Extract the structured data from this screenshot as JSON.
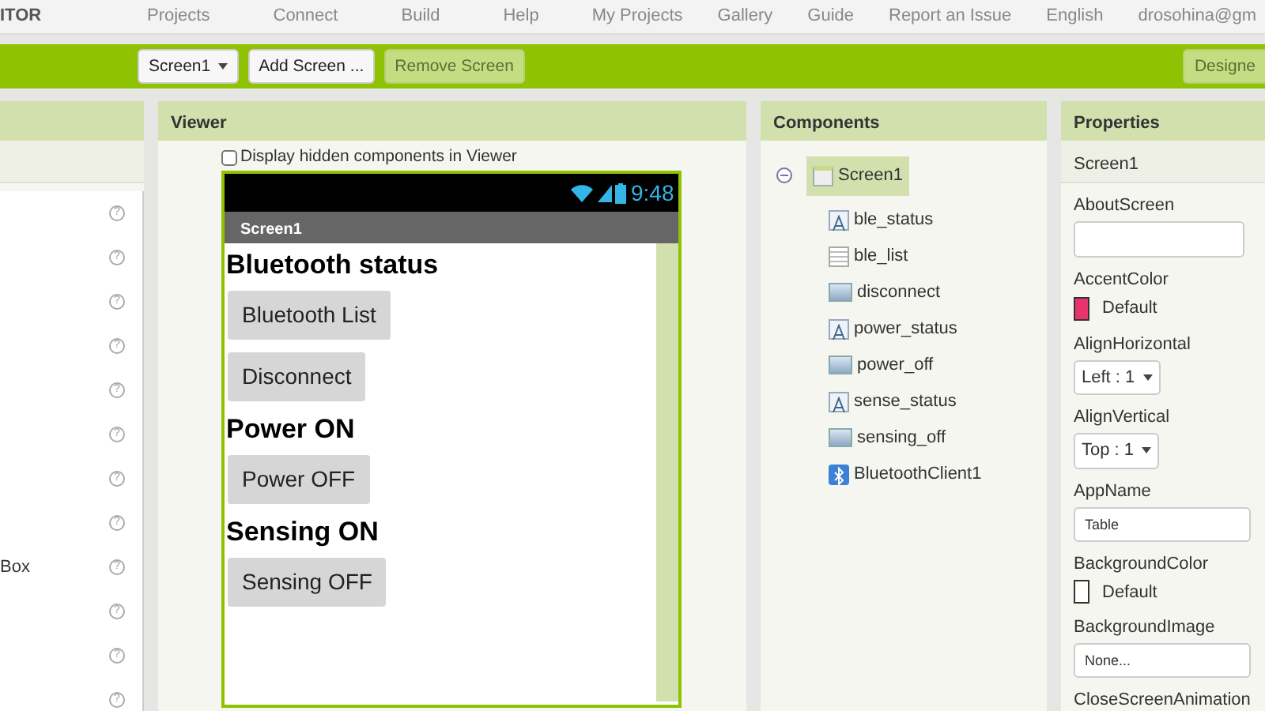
{
  "top_nav": {
    "logo": "ITOR",
    "left_links": [
      "Projects",
      "Connect",
      "Build",
      "Help"
    ],
    "right_links": [
      "My Projects",
      "Gallery",
      "Guide",
      "Report an Issue",
      "English",
      "drosohina@gm"
    ]
  },
  "toolbar": {
    "screen_select": "Screen1",
    "buttons": [
      {
        "label": "Add Screen ...",
        "disabled": false
      },
      {
        "label": "Remove Screen",
        "disabled": true
      }
    ],
    "designer": "Designe"
  },
  "palette": {
    "items": [
      {
        "help": "?"
      },
      {
        "help": "?"
      },
      {
        "help": "?"
      },
      {
        "help": "?"
      },
      {
        "help": "?"
      },
      {
        "help": "?"
      },
      {
        "help": "?"
      },
      {
        "help": "?"
      },
      {
        "label": "Box",
        "help": "?"
      },
      {
        "help": "?"
      },
      {
        "help": "?"
      },
      {
        "help": "?"
      }
    ]
  },
  "viewer": {
    "title": "Viewer",
    "hidden_checkbox": {
      "label": "Display hidden components in Viewer",
      "checked": false
    },
    "phone": {
      "time": "9:48",
      "screen_title": "Screen1",
      "components": [
        {
          "kind": "label",
          "text": "Bluetooth status"
        },
        {
          "kind": "button",
          "text": "Bluetooth List"
        },
        {
          "kind": "button",
          "text": "Disconnect"
        },
        {
          "kind": "label",
          "text": "Power ON"
        },
        {
          "kind": "button",
          "text": "Power OFF"
        },
        {
          "kind": "label",
          "text": "Sensing ON"
        },
        {
          "kind": "button",
          "text": "Sensing OFF"
        }
      ]
    }
  },
  "components": {
    "title": "Components",
    "root": {
      "label": "Screen1",
      "selected": true,
      "expanded": true,
      "children": [
        {
          "kind": "label",
          "label": "ble_status",
          "selected": false
        },
        {
          "kind": "listpicker",
          "label": "ble_list",
          "selected": false
        },
        {
          "kind": "button",
          "label": "disconnect",
          "selected": false
        },
        {
          "kind": "label",
          "label": "power_status",
          "selected": false
        },
        {
          "kind": "button",
          "label": "power_off",
          "selected": false
        },
        {
          "kind": "label",
          "label": "sense_status",
          "selected": false
        },
        {
          "kind": "button",
          "label": "sensing_off",
          "selected": false
        },
        {
          "kind": "bluetooth",
          "label": "BluetoothClient1",
          "selected": false
        }
      ]
    }
  },
  "properties": {
    "title": "Properties",
    "component": "Screen1",
    "items": [
      {
        "kind": "textarea",
        "label": "AboutScreen"
      },
      {
        "kind": "color",
        "label": "AccentColor",
        "value": "Default",
        "color": "#e8336e"
      },
      {
        "kind": "select",
        "label": "AlignHorizontal",
        "value": "Left : 1"
      },
      {
        "kind": "select",
        "label": "AlignVertical",
        "value": "Top : 1"
      },
      {
        "kind": "text",
        "label": "AppName",
        "value": "Table"
      },
      {
        "kind": "color",
        "label": "BackgroundColor",
        "value": "Default",
        "color": "#ffffff"
      },
      {
        "kind": "text",
        "label": "BackgroundImage",
        "value": "None..."
      },
      {
        "kind": "heading",
        "label": "CloseScreenAnimation"
      }
    ]
  }
}
